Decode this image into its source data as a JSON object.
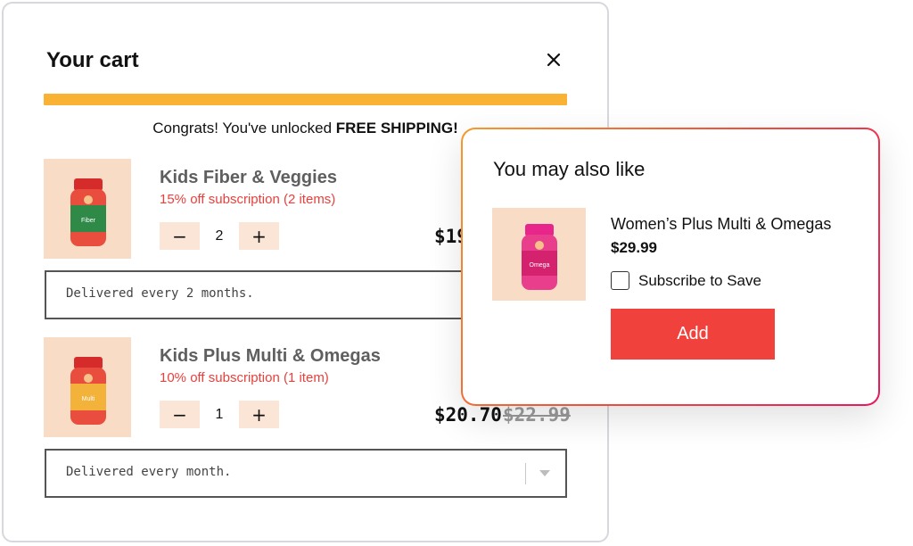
{
  "cart": {
    "title": "Your cart",
    "congrats_prefix": "Congrats! You've unlocked ",
    "congrats_bold": "FREE SHIPPING!",
    "shipping_progress": 1.0,
    "items": [
      {
        "name": "Kids Fiber & Veggies",
        "discount": "15% off subscription (2 items)",
        "quantity": "2",
        "price": "$19",
        "price_old": "",
        "frequency": "Delivered every 2 months."
      },
      {
        "name": "Kids Plus Multi & Omegas",
        "discount": "10% off subscription (1 item)",
        "quantity": "1",
        "price": "$20.70",
        "price_old": "$22.99",
        "frequency": "Delivered every month."
      }
    ],
    "minus_label": "−",
    "plus_label": "+"
  },
  "upsell": {
    "title": "You may also like",
    "product_name": "Women’s Plus Multi & Omegas",
    "product_price": "$29.99",
    "subscribe_label": "Subscribe to Save",
    "add_label": "Add"
  },
  "colors": {
    "progress": "#f9b233",
    "discount": "#e8413d",
    "add_button": "#f1413d",
    "qty_button_bg": "#fbe5d6",
    "product_bg": "#f9dcc6"
  },
  "icons": {
    "close": "close-icon",
    "dropdown": "chevron-down-icon",
    "checkbox": "checkbox-icon"
  }
}
